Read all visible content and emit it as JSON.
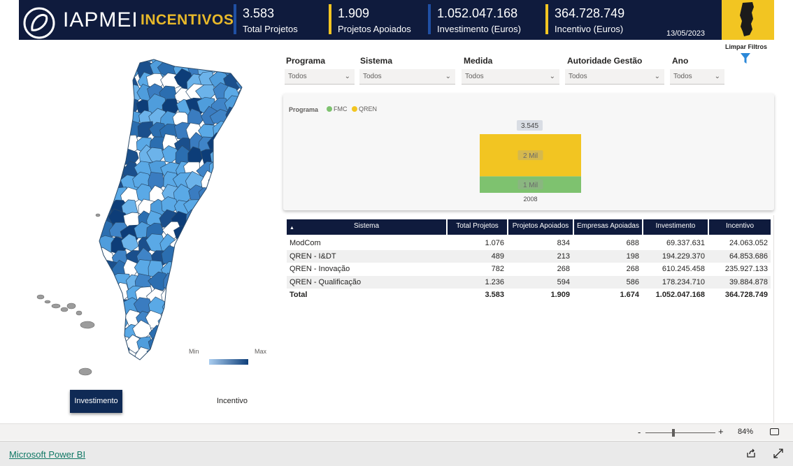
{
  "header": {
    "brand": "IAPMEI",
    "brand_sub": "INCENTIVOS",
    "kpis": [
      {
        "value": "3.583",
        "label": "Total Projetos",
        "color": "#1f4fa3"
      },
      {
        "value": "1.909",
        "label": "Projetos Apoiados",
        "color": "#f2c522"
      },
      {
        "value": "1.052.047.168",
        "label": "Investimento (Euros)",
        "color": "#1f4fa3"
      },
      {
        "value": "364.728.749",
        "label": "Incentivo (Euros)",
        "color": "#f2c522"
      }
    ],
    "date": "13/05/2023",
    "clear_filters": "Limpar Filtros"
  },
  "filters": [
    {
      "label": "Programa",
      "value": "Todos"
    },
    {
      "label": "Sistema",
      "value": "Todos"
    },
    {
      "label": "Medida",
      "value": "Todos"
    },
    {
      "label": "Autoridade Gestão",
      "value": "Todos"
    },
    {
      "label": "Ano",
      "value": "Todos"
    }
  ],
  "chart_data": {
    "type": "bar",
    "stacked": true,
    "legend_title": "Programa",
    "categories": [
      "2008"
    ],
    "series": [
      {
        "name": "FMC",
        "values": [
          1000
        ],
        "color": "#7ec26f",
        "label": "1 Mil"
      },
      {
        "name": "QREN",
        "values": [
          2545
        ],
        "color": "#f2c522",
        "label": "2 Mil"
      }
    ],
    "total_label": "3.545"
  },
  "table": {
    "columns": [
      "Sistema",
      "Total Projetos",
      "Projetos Apoiados",
      "Empresas Apoiadas",
      "Investimento",
      "Incentivo"
    ],
    "rows": [
      [
        "ModCom",
        "1.076",
        "834",
        "688",
        "69.337.631",
        "24.063.052"
      ],
      [
        "QREN - I&DT",
        "489",
        "213",
        "198",
        "194.229.370",
        "64.853.686"
      ],
      [
        "QREN - Inovação",
        "782",
        "268",
        "268",
        "610.245.458",
        "235.927.133"
      ],
      [
        "QREN - Qualificação",
        "1.236",
        "594",
        "586",
        "178.234.710",
        "39.884.878"
      ]
    ],
    "total": [
      "Total",
      "3.583",
      "1.909",
      "1.674",
      "1.052.047.168",
      "364.728.749"
    ]
  },
  "map": {
    "legend_min": "Min",
    "legend_max": "Max",
    "buttons": {
      "investimento": "Investimento",
      "incentivo": "Incentivo"
    },
    "colors": {
      "low": "#5aa9e6",
      "high": "#0d3d78",
      "none": "#ffffff"
    }
  },
  "footer": {
    "zoom_minus": "-",
    "zoom_plus": "+",
    "zoom_pct": "84%",
    "zoom_level": 0.4,
    "link": "Microsoft Power BI"
  }
}
